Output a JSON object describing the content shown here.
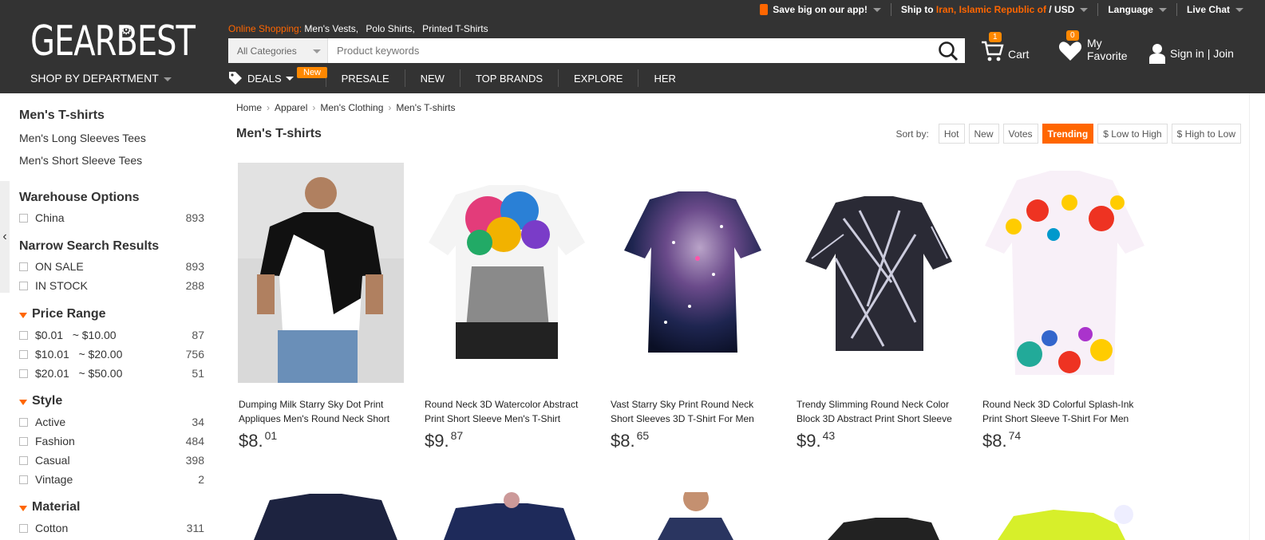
{
  "header": {
    "logo": "GEARBEST",
    "shop_by_department": "SHOP BY DEPARTMENT",
    "topbar": {
      "app": "Save big on our app!",
      "ship_to_label": "Ship to",
      "ship_to_country": "Iran, Islamic Republic of",
      "currency": "/ USD",
      "language": "Language",
      "live_chat": "Live Chat"
    },
    "online_shopping_label": "Online Shopping:",
    "online_shopping_links": [
      "Men's Vests,",
      "Polo Shirts,",
      "Printed T-Shirts"
    ],
    "search": {
      "category": "All Categories",
      "placeholder": "Product keywords"
    },
    "cart": {
      "label": "Cart",
      "count": "1"
    },
    "favorite": {
      "label_line1": "My",
      "label_line2": "Favorite",
      "count": "0"
    },
    "signin": "Sign in | Join",
    "nav": {
      "deals": "DEALS",
      "new_badge": "New",
      "items": [
        "PRESALE",
        "NEW",
        "TOP BRANDS",
        "EXPLORE",
        "HER"
      ]
    }
  },
  "sidebar": {
    "category_title": "Men's T-shirts",
    "category_links": [
      "Men's Long Sleeves Tees",
      "Men's Short Sleeve Tees"
    ],
    "warehouse_title": "Warehouse Options",
    "warehouse": [
      {
        "label": "China",
        "count": "893"
      }
    ],
    "narrow_title": "Narrow Search Results",
    "narrow": [
      {
        "label": "ON SALE",
        "count": "893"
      },
      {
        "label": "IN STOCK",
        "count": "288"
      }
    ],
    "price_title": "Price Range",
    "price": [
      {
        "label": "$0.01   ~ $10.00",
        "count": "87"
      },
      {
        "label": "$10.01   ~ $20.00",
        "count": "756"
      },
      {
        "label": "$20.01   ~ $50.00",
        "count": "51"
      }
    ],
    "style_title": "Style",
    "style": [
      {
        "label": "Active",
        "count": "34"
      },
      {
        "label": "Fashion",
        "count": "484"
      },
      {
        "label": "Casual",
        "count": "398"
      },
      {
        "label": "Vintage",
        "count": "2"
      }
    ],
    "material_title": "Material",
    "material": [
      {
        "label": "Cotton",
        "count": "311"
      }
    ]
  },
  "main": {
    "breadcrumb": [
      "Home",
      "Apparel",
      "Men's Clothing",
      "Men's T-shirts"
    ],
    "title": "Men's T-shirts",
    "sort_label": "Sort by:",
    "sort_options": [
      "Hot",
      "New",
      "Votes",
      "Trending",
      "$ Low to High",
      "$ High to Low"
    ],
    "sort_active": "Trending",
    "products": [
      {
        "name": "Dumping Milk Starry Sky Dot Print Appliques Men's Round Neck Short",
        "price_main": "$8.",
        "price_cents": "01"
      },
      {
        "name": "Round Neck 3D Watercolor Abstract Print Short Sleeve Men's T-Shirt",
        "price_main": "$9.",
        "price_cents": "87"
      },
      {
        "name": "Vast Starry Sky Print Round Neck Short Sleeves 3D T-Shirt For Men",
        "price_main": "$8.",
        "price_cents": "65"
      },
      {
        "name": "Trendy Slimming Round Neck Color Block 3D Abstract Print Short Sleeve",
        "price_main": "$9.",
        "price_cents": "43"
      },
      {
        "name": "Round Neck 3D Colorful Splash-Ink Print Short Sleeve T-Shirt For Men",
        "price_main": "$8.",
        "price_cents": "74"
      }
    ]
  },
  "colors": {
    "accent": "#ff6600",
    "header_bg": "#333333",
    "badge": "#ff8800"
  }
}
